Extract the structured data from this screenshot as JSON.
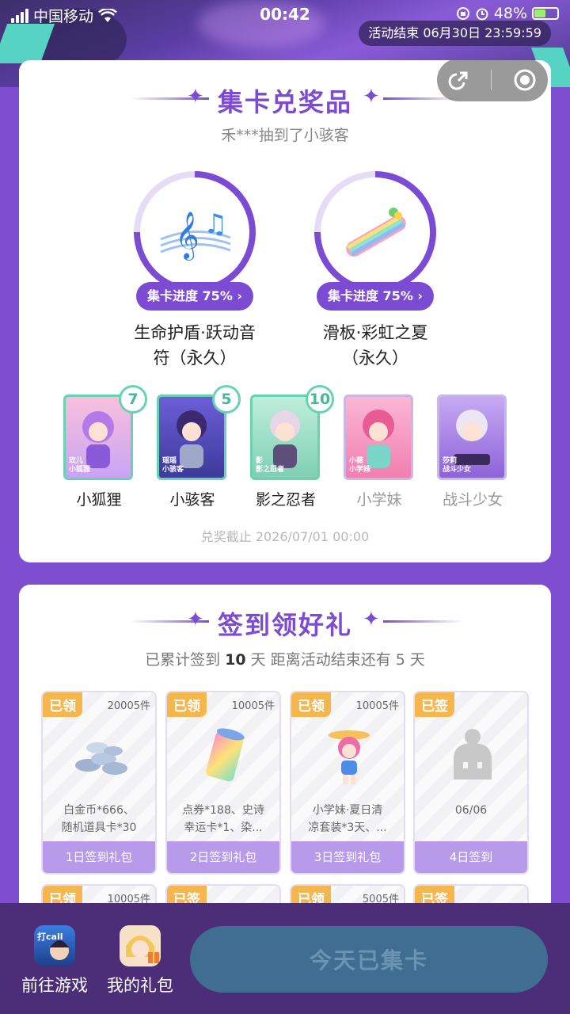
{
  "status_bar": {
    "carrier": "中国移动",
    "time": "00:42",
    "battery_text": "48%",
    "battery_level": 0.48
  },
  "event_end": "活动结束 06月30日 23:59:59",
  "collect_section": {
    "title": "集卡兑奖品",
    "ticker": "禾***抽到了小骇客",
    "prizes": [
      {
        "progress_label": "集卡进度 75%",
        "progress": 0.75,
        "name_line1": "生命护盾·跃动音",
        "name_line2": "符（永久）"
      },
      {
        "progress_label": "集卡进度 75%",
        "progress": 0.75,
        "name_line1": "滑板·彩虹之夏",
        "name_line2": "（永久）"
      }
    ],
    "heroes": [
      {
        "name": "小狐狸",
        "count": "7",
        "tag1": "玫儿",
        "tag2": "小狐狸",
        "color": "#f2a7c9"
      },
      {
        "name": "小骇客",
        "count": "5",
        "tag1": "瑶瑶",
        "tag2": "小骇客",
        "color": "#5b4fb5"
      },
      {
        "name": "影之忍者",
        "count": "10",
        "tag1": "影",
        "tag2": "影之忍者",
        "color": "#a7e0c9"
      },
      {
        "name": "小学妹",
        "tag1": "小薇",
        "tag2": "小学妹",
        "color": "#f59ac4"
      },
      {
        "name": "战斗少女",
        "tag1": "莎莉",
        "tag2": "战斗少女",
        "color": "#b79bea"
      }
    ],
    "deadline": "兑奖截止 2026/07/01 00:00"
  },
  "signin_section": {
    "title": "签到领好礼",
    "summary_prefix": "已累计签到",
    "signed_days": "10",
    "summary_mid": "天  距离活动结束还有",
    "remaining_days": "5",
    "summary_suffix": "天",
    "days": [
      {
        "chip": "已领",
        "count": "20005件",
        "desc1": "白金币*666、",
        "desc2": "随机道具卡*30",
        "footer": "1日签到礼包"
      },
      {
        "chip": "已领",
        "count": "10005件",
        "desc1": "点券*188、史诗",
        "desc2": "幸运卡*1、染...",
        "footer": "2日签到礼包"
      },
      {
        "chip": "已领",
        "count": "10005件",
        "desc1": "小学妹·夏日清",
        "desc2": "凉套装*3天、...",
        "footer": "3日签到礼包"
      },
      {
        "chip": "已签",
        "count": "",
        "desc1": "06/06",
        "desc2": "",
        "footer": "4日签到"
      }
    ],
    "next_row": [
      {
        "chip": "已领",
        "count": "10005件"
      },
      {
        "chip": "已签",
        "count": ""
      },
      {
        "chip": "已领",
        "count": "5005件"
      },
      {
        "chip": "已签",
        "count": ""
      }
    ]
  },
  "bottom_bar": {
    "goto_game": "前往游戏",
    "my_gifts": "我的礼包",
    "main_button": "今天已集卡",
    "game_icon_text": "打call"
  }
}
